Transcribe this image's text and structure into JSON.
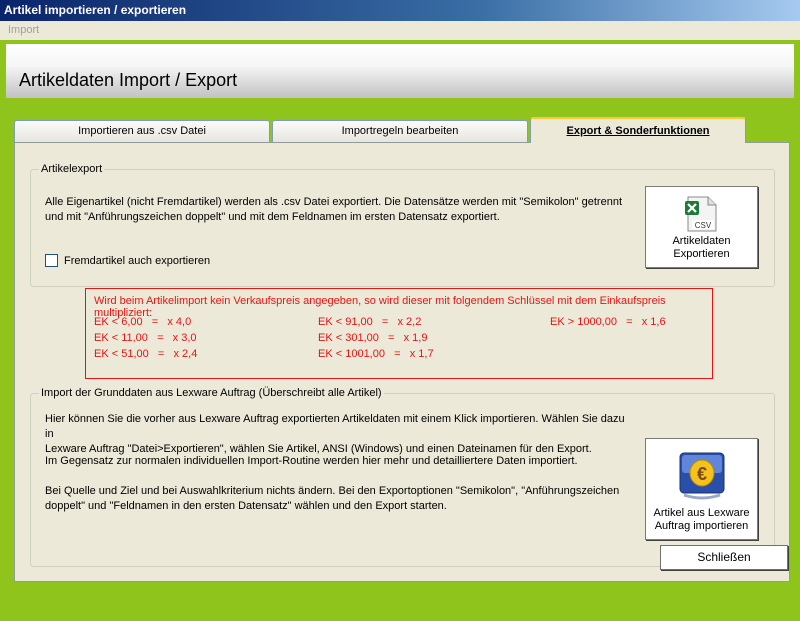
{
  "window": {
    "title": "Artikel importieren / exportieren"
  },
  "menu": {
    "items": [
      "Import"
    ]
  },
  "header": {
    "title": "Artikeldaten Import / Export"
  },
  "tabs": [
    {
      "label": "Importieren aus .csv Datei",
      "active": false
    },
    {
      "label": "Importregeln bearbeiten",
      "active": false
    },
    {
      "label": "Export & Sonderfunktionen",
      "active": true
    }
  ],
  "export_group": {
    "legend": "Artikelexport",
    "description_line1": "Alle Eigenartikel (nicht Fremdartikel) werden als .csv Datei exportiert. Die Datensätze werden mit \"Semikolon\" getrennt",
    "description_line2": "und mit \"Anführungszeichen doppelt\" und mit dem Feldnamen im ersten Datensatz exportiert.",
    "checkbox_label": "Fremdartikel auch exportieren",
    "checkbox_checked": false,
    "button_line1": "Artikeldaten",
    "button_line2": "Exportieren",
    "button_icon": "csv-file-icon"
  },
  "price_rules": {
    "heading": "Wird beim Artikelimport kein Verkaufspreis angegeben, so wird dieser mit folgendem Schlüssel mit dem Einkaufspreis multipliziert:",
    "col1": [
      "EK < 6,00   =   x 4,0",
      "EK < 11,00   =   x 3,0",
      "EK < 51,00   =   x 2,4"
    ],
    "col2": [
      "EK < 91,00   =   x 2,2",
      "EK < 301,00   =   x 1,9",
      "EK < 1001,00   =   x 1,7"
    ],
    "col3": [
      "EK > 1000,00   =   x 1,6"
    ],
    "color": "#e81414"
  },
  "import_group": {
    "legend": "Import der Grunddaten aus Lexware Auftrag (Überschreibt alle Artikel)",
    "para1_line1": "Hier können Sie die vorher aus Lexware Auftrag exportierten Artikeldaten mit einem Klick importieren. Wählen Sie dazu in",
    "para1_line2": "Lexware Auftrag \"Datei>Exportieren\", wählen Sie Artikel, ANSI (Windows) und einen Dateinamen für den Export.",
    "para2": "Im Gegensatz zur normalen individuellen Import-Routine werden hier mehr und detailliertere Daten importiert.",
    "para3_line1": "Bei Quelle und Ziel und bei Auswahlkriterium nichts ändern.  Bei den Exportoptionen \"Semikolon\", \"Anführungszeichen",
    "para3_line2": "doppelt\" und \"Feldnamen in den ersten Datensatz\" wählen und den Export starten.",
    "button_line1": "Artikel aus Lexware",
    "button_line2": "Auftrag importieren",
    "button_icon": "lexware-euro-icon"
  },
  "footer": {
    "close_label": "Schließen"
  },
  "colors": {
    "accent_green": "#8fc41c",
    "titlebar": "#0a246a"
  }
}
